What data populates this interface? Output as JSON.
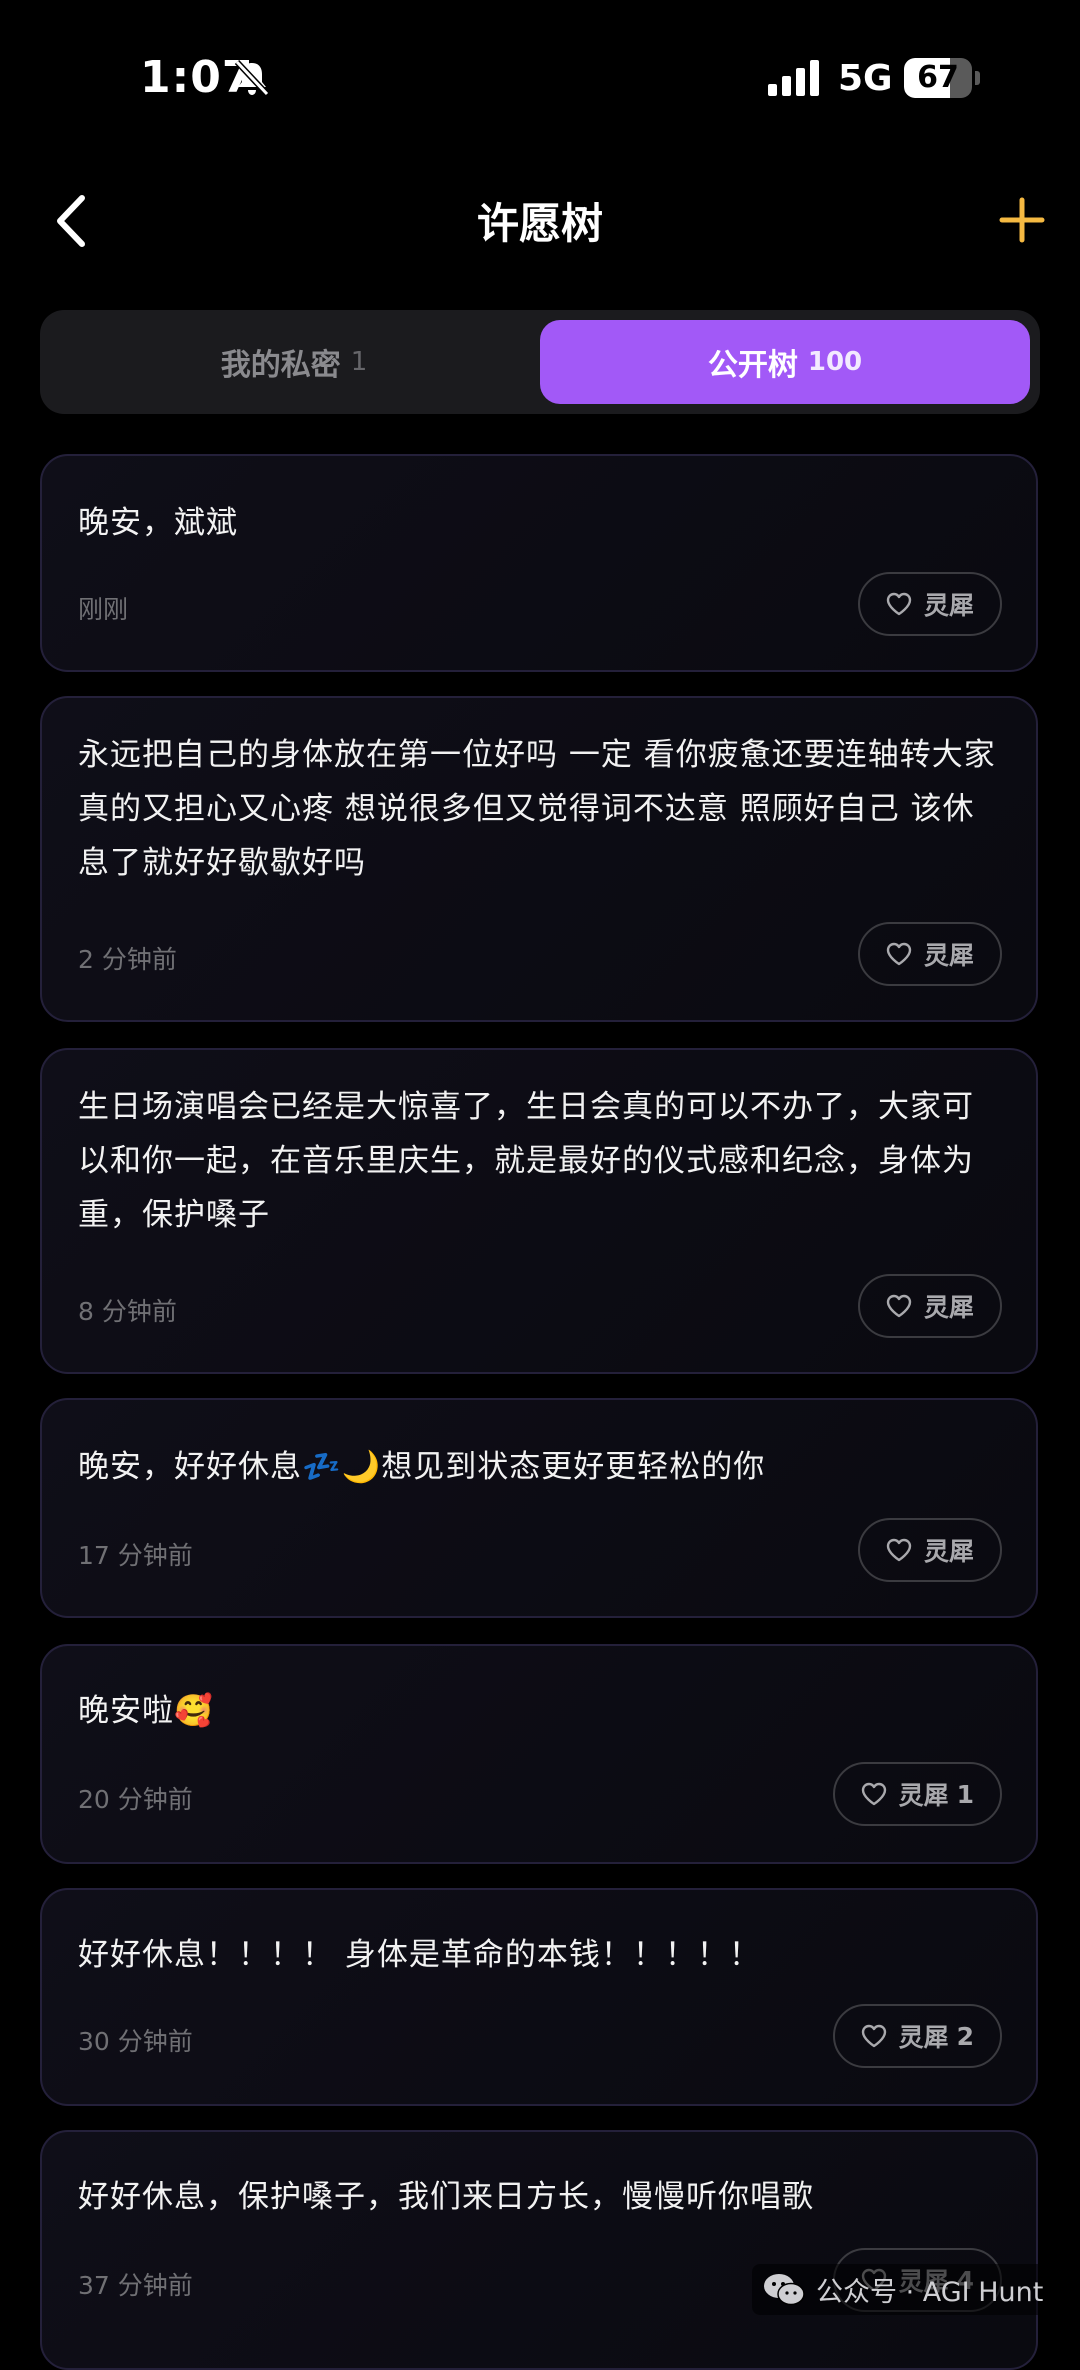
{
  "status_bar": {
    "time": "1:07",
    "network": "5G",
    "battery": "67",
    "battery_level": 0.67
  },
  "header": {
    "title": "许愿树"
  },
  "tabs": [
    {
      "label": "我的私密",
      "count": "1",
      "active": false
    },
    {
      "label": "公开树",
      "count": "100",
      "active": true
    }
  ],
  "wishes": [
    {
      "text": "晚安，斌斌",
      "time": "刚刚",
      "like_label": "灵犀",
      "like_count": ""
    },
    {
      "text": "永远把自己的身体放在第一位好吗 一定 看你疲惫还要连轴转大家真的又担心又心疼 想说很多但又觉得词不达意 照顾好自己 该休息了就好好歇歇好吗",
      "time": "2 分钟前",
      "like_label": "灵犀",
      "like_count": ""
    },
    {
      "text": "生日场演唱会已经是大惊喜了，生日会真的可以不办了，大家可以和你一起，在音乐里庆生，就是最好的仪式感和纪念，身体为重，保护嗓子",
      "time": "8 分钟前",
      "like_label": "灵犀",
      "like_count": ""
    },
    {
      "text": "晚安，好好休息💤🌙想见到状态更好更轻松的你",
      "time": "17 分钟前",
      "like_label": "灵犀",
      "like_count": ""
    },
    {
      "text": "晚安啦🥰",
      "time": "20 分钟前",
      "like_label": "灵犀",
      "like_count": "1"
    },
    {
      "text": "好好休息！！！！ 身体是革命的本钱！！！！！",
      "time": "30 分钟前",
      "like_label": "灵犀",
      "like_count": "2"
    },
    {
      "text": "好好休息，保护嗓子，我们来日方长，慢慢听你唱歌",
      "time": "37 分钟前",
      "like_label": "灵犀",
      "like_count": "4"
    }
  ],
  "watermark": {
    "text": "公众号 · AGI Hunt"
  },
  "colors": {
    "accent": "#a259f7",
    "add_button": "#f5b942",
    "card_border": "#24203a",
    "background": "#000000"
  }
}
